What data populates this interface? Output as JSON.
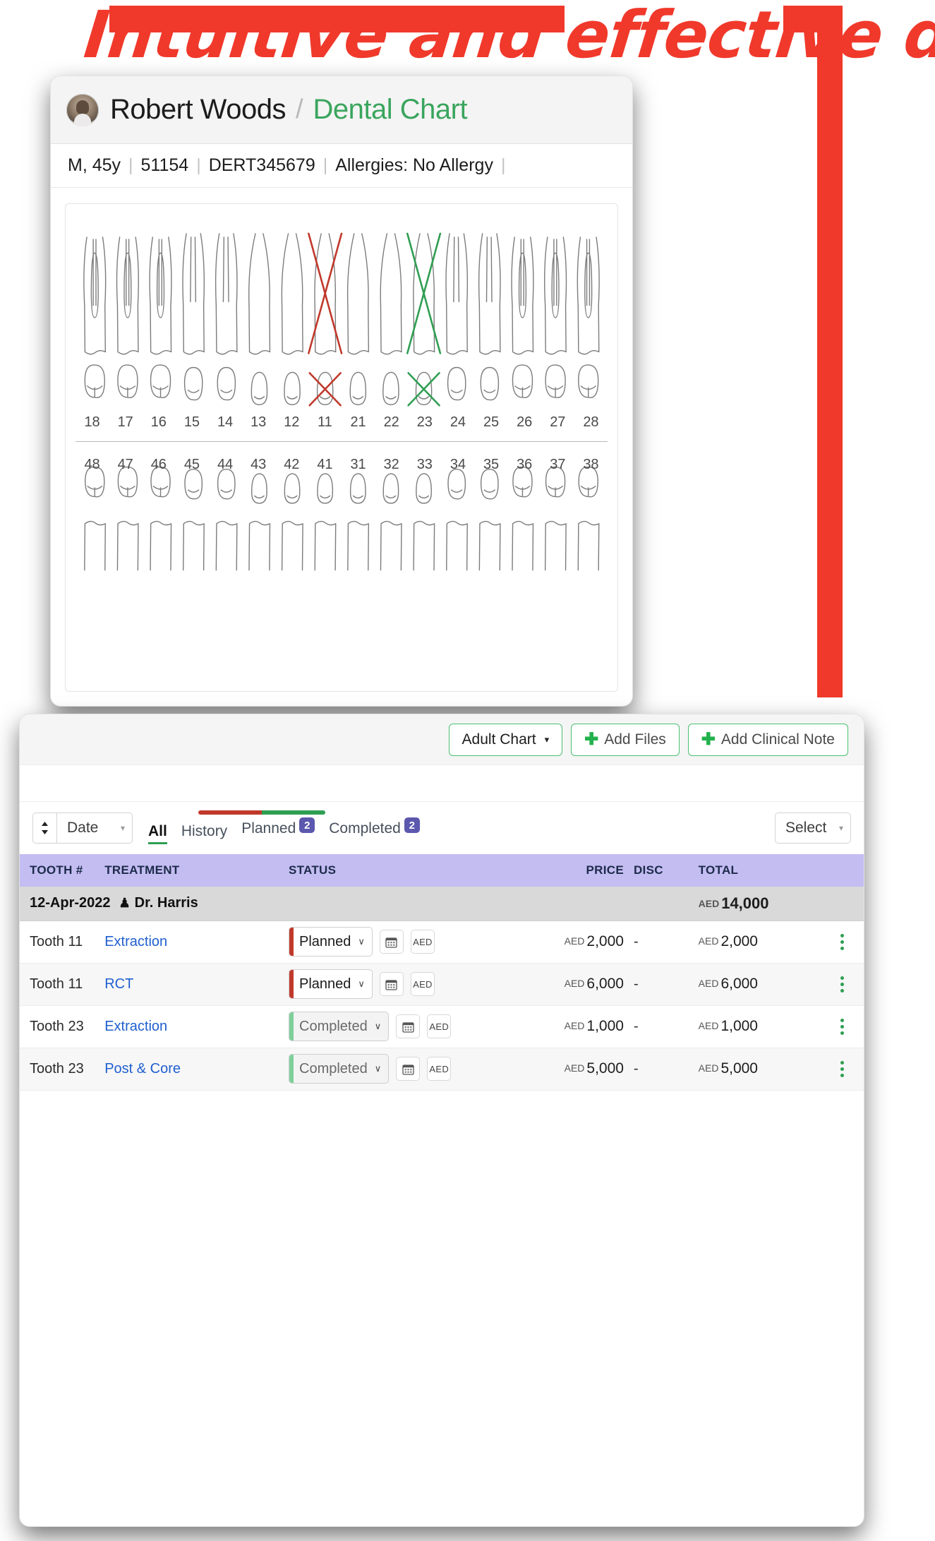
{
  "headline": {
    "text": "Intuitive and effective dental charts"
  },
  "patient": {
    "name": "Robert Woods",
    "separator": "/",
    "section": "Dental Chart",
    "avatar_icon": "patient-avatar",
    "demographics": {
      "sex_age": "M, 45y",
      "patient_id": "51154",
      "record_no": "DERT345679",
      "allergies": "Allergies: No Allergy",
      "separator": "|"
    }
  },
  "chart": {
    "upper_numbers": [
      "18",
      "17",
      "16",
      "15",
      "14",
      "13",
      "12",
      "11",
      "21",
      "22",
      "23",
      "24",
      "25",
      "26",
      "27",
      "28"
    ],
    "lower_numbers": [
      "48",
      "47",
      "46",
      "45",
      "44",
      "43",
      "42",
      "41",
      "31",
      "32",
      "33",
      "34",
      "35",
      "36",
      "37",
      "38"
    ],
    "marks": [
      {
        "tooth": "11",
        "type": "extraction-cross",
        "color": "#c0392b"
      },
      {
        "tooth": "23",
        "type": "extraction-cross",
        "color": "#2f9e52"
      }
    ],
    "colors": {
      "planned": "#c0392b",
      "completed": "#2f9e52",
      "tooth_outline": "#7c7c7c"
    }
  },
  "toolbar": {
    "chart_type_label": "Adult Chart",
    "chart_type_caret": "▾",
    "add_files_label": "Add Files",
    "add_clinical_note_label": "Add Clinical Note",
    "plus_glyph": "✛"
  },
  "filters": {
    "sort_arrows_glyph": "⬍",
    "sort_value": "Date",
    "caret": "▾",
    "tabs": [
      {
        "label": "All",
        "badge": "",
        "active": true
      },
      {
        "label": "History",
        "badge": "",
        "active": false
      },
      {
        "label": "Planned",
        "badge": "2",
        "active": false
      },
      {
        "label": "Completed",
        "badge": "2",
        "active": false
      }
    ],
    "progress": {
      "red_pct": 50,
      "green_pct": 50
    },
    "select_value": "Select"
  },
  "table": {
    "columns": [
      "TOOTH #",
      "TREATMENT",
      "STATUS",
      "PRICE",
      "DISC",
      "TOTAL"
    ],
    "group": {
      "date": "12-Apr-2022",
      "doctor_icon": "doctor-icon",
      "doctor": "Dr. Harris",
      "total_currency": "AED",
      "total_amount": "14,000"
    },
    "currency": "AED",
    "date_icon": "calendar-icon",
    "currency_btn_label": "AED",
    "menu_icon": "kebab-menu-icon",
    "rows": [
      {
        "tooth": "Tooth 11",
        "treatment": "Extraction",
        "status": "Planned",
        "status_kind": "planned",
        "price_currency": "AED",
        "price": "2,000",
        "disc": "-",
        "total_currency": "AED",
        "total": "2,000"
      },
      {
        "tooth": "Tooth 11",
        "treatment": "RCT",
        "status": "Planned",
        "status_kind": "planned",
        "price_currency": "AED",
        "price": "6,000",
        "disc": "-",
        "total_currency": "AED",
        "total": "6,000"
      },
      {
        "tooth": "Tooth 23",
        "treatment": "Extraction",
        "status": "Completed",
        "status_kind": "completed",
        "price_currency": "AED",
        "price": "1,000",
        "disc": "-",
        "total_currency": "AED",
        "total": "1,000"
      },
      {
        "tooth": "Tooth 23",
        "treatment": "Post & Core",
        "status": "Completed",
        "status_kind": "completed",
        "price_currency": "AED",
        "price": "5,000",
        "disc": "-",
        "total_currency": "AED",
        "total": "5,000"
      }
    ]
  },
  "colors": {
    "accent_green": "#2f9e52",
    "accent_red": "#f0392b",
    "badge_purple": "#5b58ae",
    "table_header": "#c3bdf2",
    "link_blue": "#1f5fd0"
  }
}
